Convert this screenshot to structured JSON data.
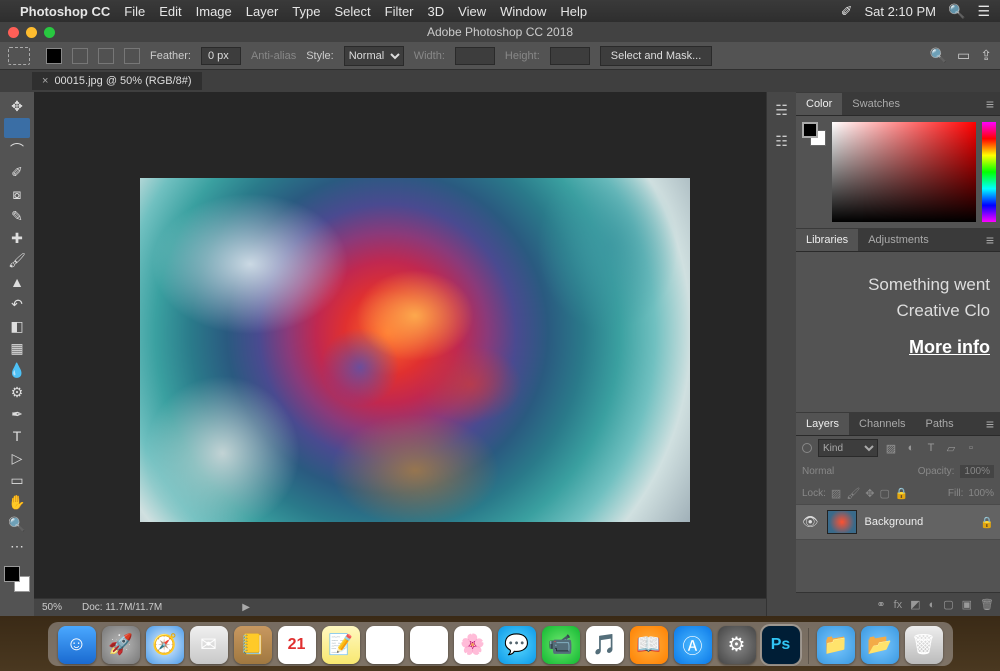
{
  "mac_menu": {
    "app_name": "Photoshop CC",
    "items": [
      "File",
      "Edit",
      "Image",
      "Layer",
      "Type",
      "Select",
      "Filter",
      "3D",
      "View",
      "Window",
      "Help"
    ],
    "clock": "Sat 2:10 PM"
  },
  "app_title": "Adobe Photoshop CC 2018",
  "options_bar": {
    "feather_label": "Feather:",
    "feather_value": "0 px",
    "antialias_label": "Anti-alias",
    "style_label": "Style:",
    "style_value": "Normal",
    "width_label": "Width:",
    "height_label": "Height:",
    "select_mask": "Select and Mask..."
  },
  "doc_tab": {
    "title": "00015.jpg @ 50% (RGB/8#)"
  },
  "status_bar": {
    "zoom": "50%",
    "doc": "Doc: 11.7M/11.7M"
  },
  "panels": {
    "color": {
      "tabs": [
        "Color",
        "Swatches"
      ],
      "active": 0
    },
    "libraries": {
      "tabs": [
        "Libraries",
        "Adjustments"
      ],
      "active": 0,
      "message_line1": "Something went",
      "message_line2": "Creative Clo",
      "link": "More info"
    },
    "layers": {
      "tabs": [
        "Layers",
        "Channels",
        "Paths"
      ],
      "active": 0,
      "kind_placeholder": "Kind",
      "blend_mode": "Normal",
      "opacity_label": "Opacity:",
      "opacity_value": "100%",
      "lock_label": "Lock:",
      "fill_label": "Fill:",
      "fill_value": "100%",
      "layer_name": "Background"
    }
  },
  "dock": {
    "apps": [
      {
        "name": "finder",
        "bg": "linear-gradient(#4aa8ff,#1a6ad0)",
        "glyph": "☺"
      },
      {
        "name": "launchpad",
        "bg": "radial-gradient(#bbb,#777)",
        "glyph": "🚀"
      },
      {
        "name": "safari",
        "bg": "radial-gradient(#e8f4ff,#4a9ae8)",
        "glyph": "🧭"
      },
      {
        "name": "mail",
        "bg": "linear-gradient(#f0f0f0,#c8c8c8)",
        "glyph": "✉"
      },
      {
        "name": "contacts",
        "bg": "linear-gradient(#c89860,#a07840)",
        "glyph": "📒"
      },
      {
        "name": "calendar",
        "bg": "#fff",
        "glyph": "21"
      },
      {
        "name": "notes",
        "bg": "linear-gradient(#fff8c0,#f8e870)",
        "glyph": "📝"
      },
      {
        "name": "reminders",
        "bg": "#fff",
        "glyph": "☑"
      },
      {
        "name": "preview",
        "bg": "#fff",
        "glyph": "🖼"
      },
      {
        "name": "photos",
        "bg": "#fff",
        "glyph": "🌸"
      },
      {
        "name": "messages",
        "bg": "radial-gradient(#5ad8ff,#0a98e8)",
        "glyph": "💬"
      },
      {
        "name": "facetime",
        "bg": "radial-gradient(#70e870,#10b830)",
        "glyph": "📹"
      },
      {
        "name": "itunes",
        "bg": "#fff",
        "glyph": "🎵"
      },
      {
        "name": "ibooks",
        "bg": "radial-gradient(#ffb040,#ff8000)",
        "glyph": "📖"
      },
      {
        "name": "appstore",
        "bg": "radial-gradient(#4ab8ff,#0a78e8)",
        "glyph": "Ⓐ"
      },
      {
        "name": "settings",
        "bg": "radial-gradient(#888,#444)",
        "glyph": "⚙"
      },
      {
        "name": "photoshop",
        "bg": "#001e36",
        "glyph": "Ps"
      }
    ],
    "right": [
      {
        "name": "downloads",
        "bg": "radial-gradient(#7ac8ff,#3a98e0)",
        "glyph": "📁"
      },
      {
        "name": "documents",
        "bg": "radial-gradient(#7ac8ff,#3a98e0)",
        "glyph": "📂"
      },
      {
        "name": "trash",
        "bg": "linear-gradient(#eee,#bbb)",
        "glyph": "🗑"
      }
    ]
  }
}
